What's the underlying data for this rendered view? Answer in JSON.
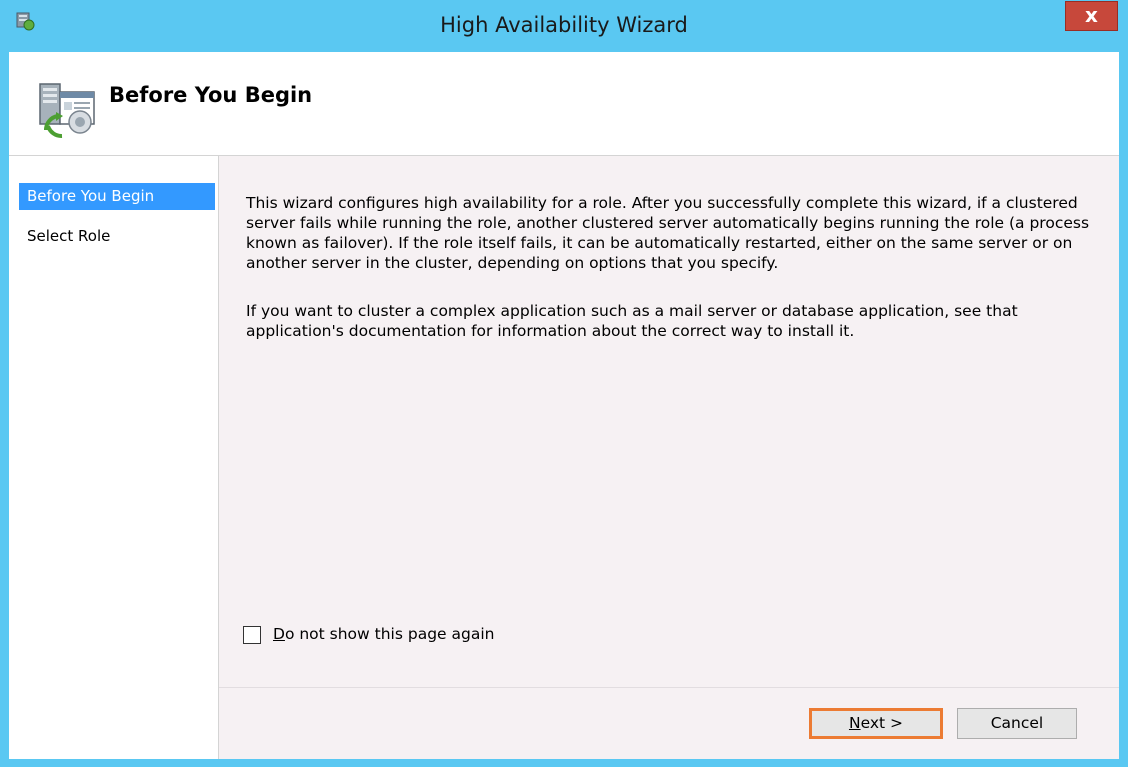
{
  "window": {
    "title": "High Availability Wizard",
    "close_label": "x"
  },
  "header": {
    "title": "Before You Begin"
  },
  "sidebar": {
    "items": [
      {
        "label": "Before You Begin",
        "active": true
      },
      {
        "label": "Select Role",
        "active": false
      }
    ]
  },
  "main": {
    "paragraphs": [
      "This wizard configures high availability for a role. After you successfully complete this wizard, if a clustered server fails while running the role, another clustered server automatically begins running the role (a process known as failover). If the role itself fails, it can be automatically restarted, either on the same server or on another server in the cluster, depending on options that you specify.",
      "If you want to cluster a complex application such as a mail server or database application, see that application's documentation for information about the correct way to install it."
    ],
    "checkbox": {
      "label_accel": "D",
      "label_rest": "o not show this page again",
      "checked": false
    }
  },
  "buttons": {
    "next_accel": "N",
    "next_rest": "ext >",
    "cancel": "Cancel"
  },
  "colors": {
    "frame": "#5ac8f2",
    "close": "#c7483b",
    "selection": "#3399ff",
    "focus_border": "#ec7b33"
  },
  "icons": {
    "app": "wizard-app-icon",
    "header": "cluster-server-icon"
  }
}
